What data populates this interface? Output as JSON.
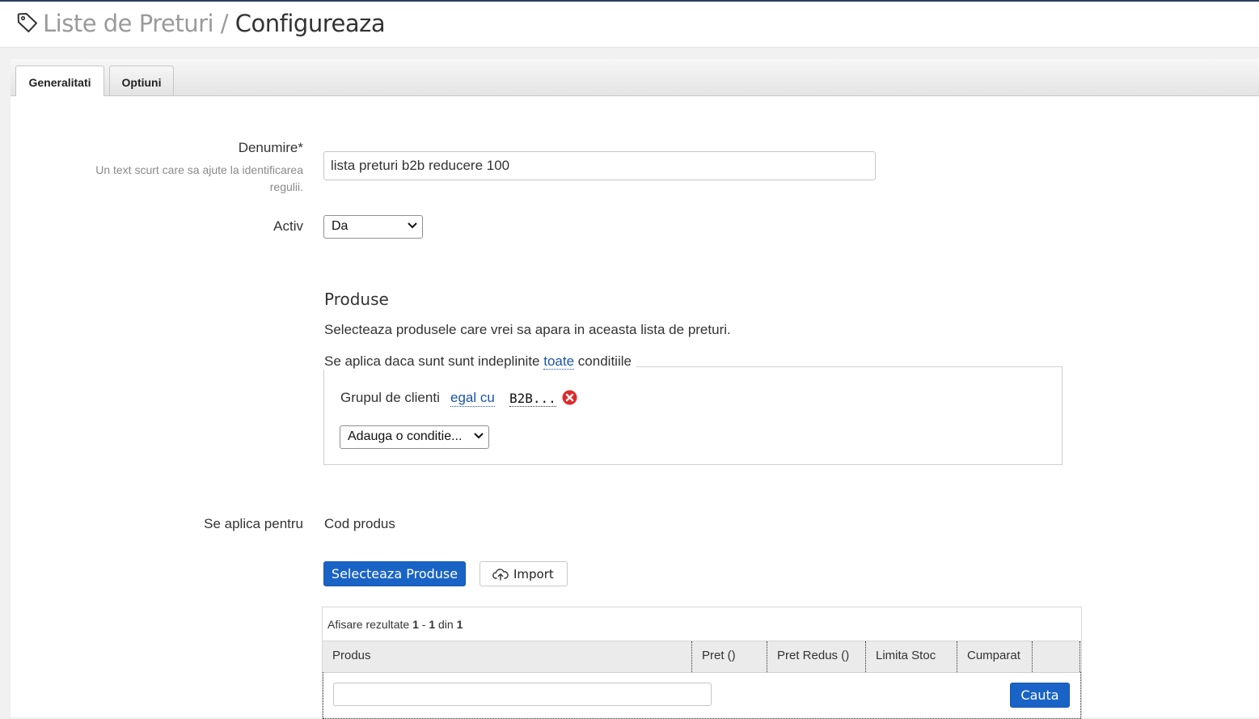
{
  "header": {
    "breadcrumb_root": "Liste de Preturi",
    "breadcrumb_sep": "/",
    "breadcrumb_current": "Configureaza"
  },
  "tabs": [
    {
      "label": "Generalitati",
      "active": true
    },
    {
      "label": "Optiuni",
      "active": false
    }
  ],
  "form": {
    "name_label": "Denumire*",
    "name_help": "Un text scurt care sa ajute la identificarea regulii.",
    "name_value": "lista preturi b2b reducere 100",
    "active_label": "Activ",
    "active_value": "Da"
  },
  "products": {
    "title": "Produse",
    "subtitle": "Selecteaza produsele care vrei sa apara in aceasta lista de preturi.",
    "condition_prefix": "Se aplica daca sunt sunt indeplinite",
    "condition_link": "toate",
    "condition_suffix": "conditiile",
    "rule": {
      "field": "Grupul de clienti",
      "operator": "egal cu",
      "value": "B2B..."
    },
    "add_condition": "Adauga o conditie..."
  },
  "apply": {
    "label": "Se aplica pentru",
    "value": "Cod produs",
    "select_button": "Selecteaza Produse",
    "import_button": "Import"
  },
  "grid": {
    "info_prefix": "Afisare rezultate",
    "from": "1",
    "dash": "-",
    "to": "1",
    "of": "din",
    "total": "1",
    "columns": [
      "Produs",
      "Pret ()",
      "Pret Redus ()",
      "Limita Stoc",
      "Cumparat"
    ],
    "search_value": "",
    "search_button": "Cauta"
  },
  "colors": {
    "accent": "#1a63c6",
    "link": "#1a54a8",
    "danger": "#e02a2a"
  },
  "icons": {
    "header": "tag-icon",
    "remove": "remove-condition-icon",
    "import": "cloud-upload-icon",
    "dropdown": "chevron-down-icon"
  }
}
